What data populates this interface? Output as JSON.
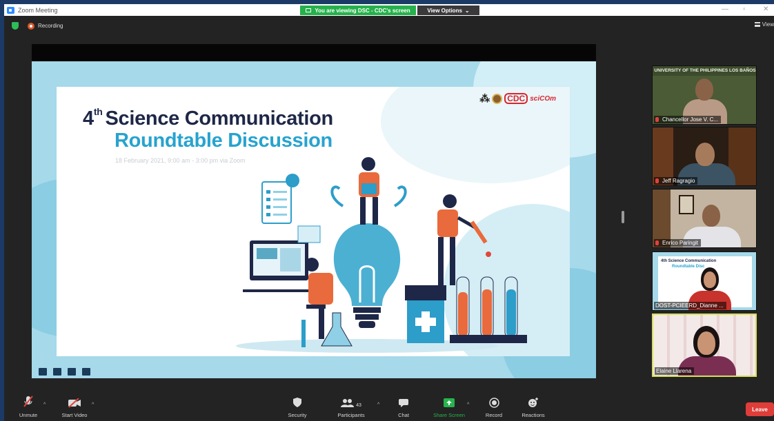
{
  "window": {
    "title": "Zoom Meeting",
    "viewing_banner": "You are viewing DSC - CDC's screen",
    "view_options": "View Options",
    "view_options_caret": "⌄",
    "minimize": "—",
    "maximize": "▫",
    "close": "✕"
  },
  "topbar": {
    "recording_label": "Recording",
    "view_label": "View"
  },
  "slide": {
    "title_number": "4",
    "title_superscript": "th",
    "title_line1": "Science Communication",
    "title_line2": "Roundtable Discussion",
    "date_line": "18 February 2021, 9:00 am - 3:00 pm via Zoom",
    "logo_mark": "⁂",
    "logo_cdc": "CDC",
    "logo_scicom": "sciCOm"
  },
  "participants": [
    {
      "name": "Chancellor Jose V. C...",
      "banner": "UNIVERSITY OF THE PHILIPPINES LOS BAÑOS",
      "muted": true
    },
    {
      "name": "Jeff Ragragio",
      "muted": true
    },
    {
      "name": "Enrico Paringit",
      "muted": true
    },
    {
      "name": "DOST-PCIEERD_Dianne ...",
      "tile_slide_title": "4th Science Communication",
      "tile_slide_sub": "Roundtable Disc",
      "muted": false
    },
    {
      "name": "Elaine Llarena",
      "muted": false,
      "active_speaker": true
    }
  ],
  "toolbar": {
    "unmute": "Unmute",
    "start_video": "Start Video",
    "security": "Security",
    "participants": "Participants",
    "participants_count": "43",
    "chat": "Chat",
    "share_screen": "Share Screen",
    "record": "Record",
    "reactions": "Reactions",
    "leave": "Leave",
    "caret": "^"
  },
  "colors": {
    "accent_green": "#27b34d",
    "leave_red": "#df3d3a",
    "active_speaker_border": "#d7df56",
    "slide_blue": "#27a3cf",
    "slide_navy": "#1e2747"
  }
}
